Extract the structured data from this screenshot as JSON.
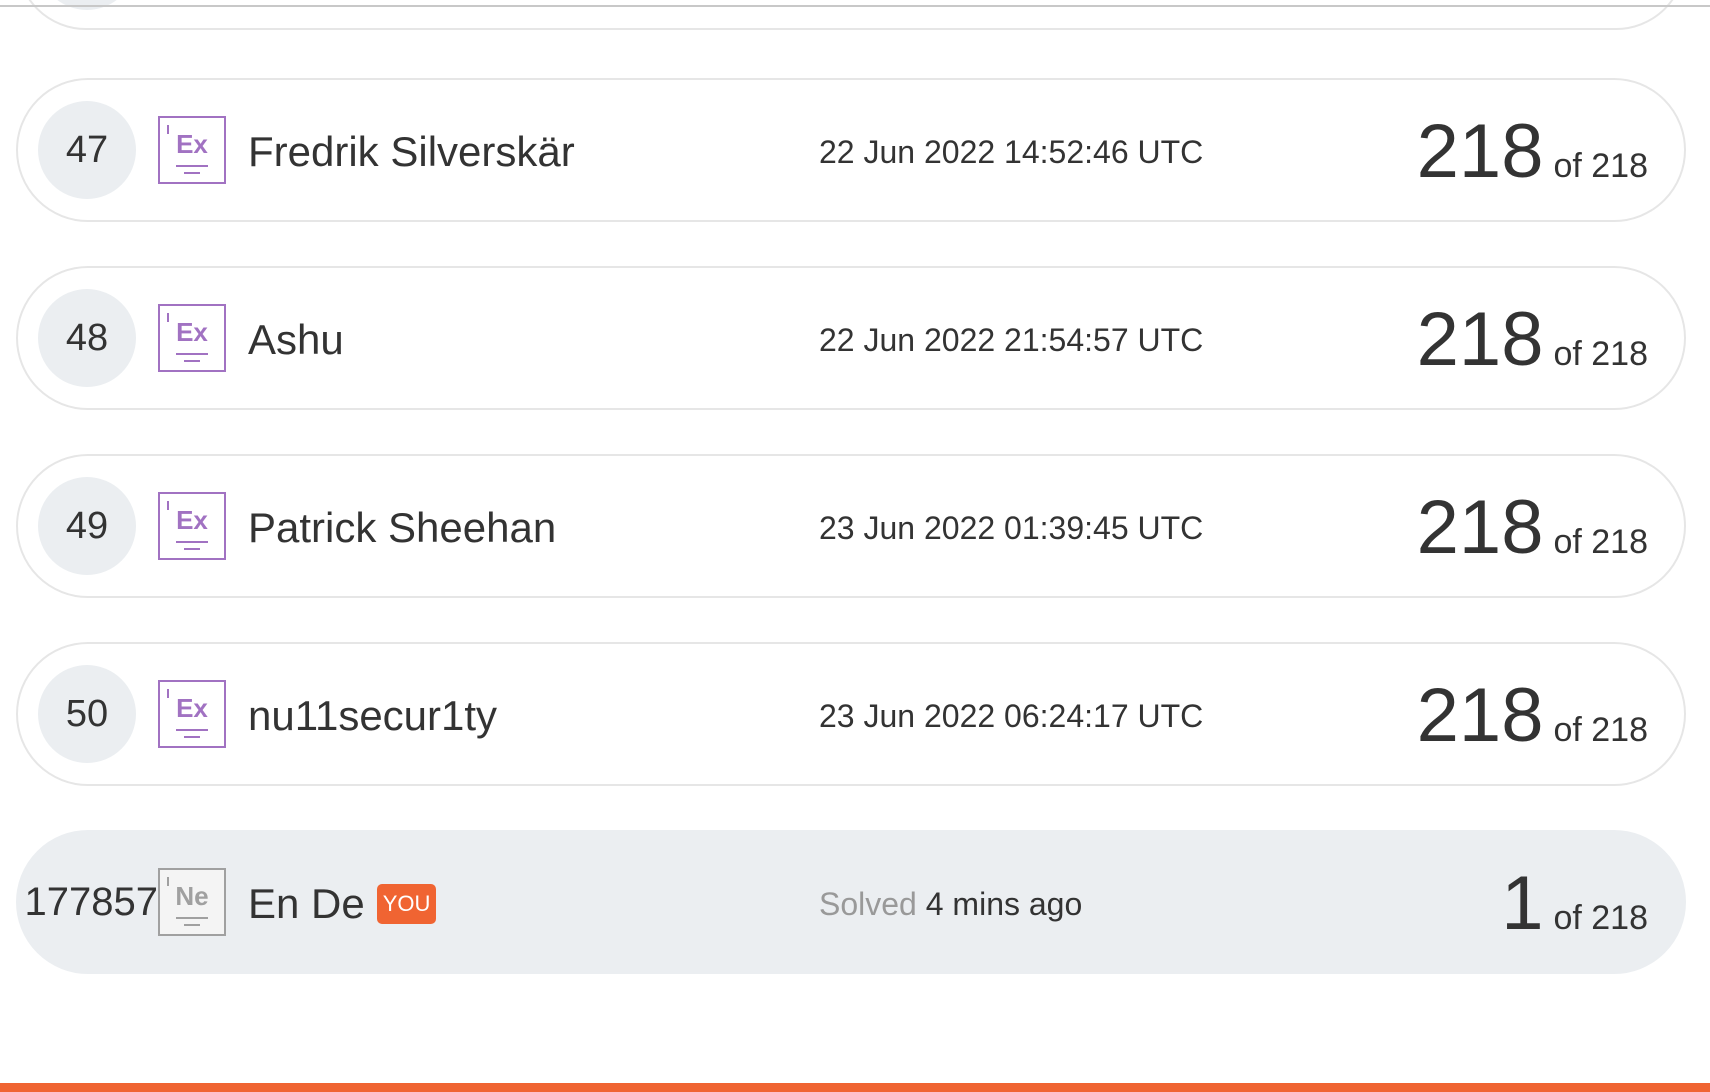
{
  "leaderboard": {
    "rows": [
      {
        "rank": "47",
        "level_badge": "Ex",
        "name": "Fredrik Silverskär",
        "date": "22 Jun 2022 14:52:46 UTC",
        "score": "218",
        "of_total": "of 218"
      },
      {
        "rank": "48",
        "level_badge": "Ex",
        "name": "Ashu",
        "date": "22 Jun 2022 21:54:57 UTC",
        "score": "218",
        "of_total": "of 218"
      },
      {
        "rank": "49",
        "level_badge": "Ex",
        "name": "Patrick Sheehan",
        "date": "23 Jun 2022 01:39:45 UTC",
        "score": "218",
        "of_total": "of 218"
      },
      {
        "rank": "50",
        "level_badge": "Ex",
        "name": "nu11secur1ty",
        "date": "23 Jun 2022 06:24:17 UTC",
        "score": "218",
        "of_total": "of 218"
      }
    ],
    "current_user": {
      "rank": "177857",
      "level_badge": "Ne",
      "name": "En De",
      "you_tag": "YOU",
      "solved_label": "Solved",
      "solved_time": "4 mins ago",
      "score": "1",
      "of_total": "of 218"
    }
  },
  "colors": {
    "accent": "#f06432",
    "expert_badge": "#a172c2",
    "novice_badge": "#a0a0a0",
    "rank_bg": "#ebeef1"
  }
}
